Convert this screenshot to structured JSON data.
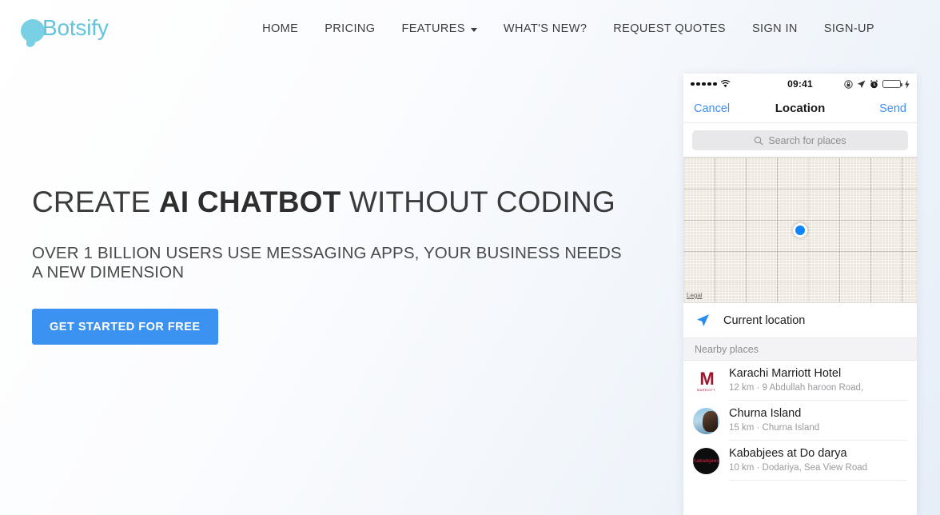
{
  "brand": {
    "name": "Botsify",
    "icon": "chat-bubble-icon",
    "color": "#62c4dd"
  },
  "nav": {
    "items": [
      {
        "label": "HOME",
        "has_caret": false
      },
      {
        "label": "PRICING",
        "has_caret": false
      },
      {
        "label": "FEATURES",
        "has_caret": true
      },
      {
        "label": "WHAT'S NEW?",
        "has_caret": false
      },
      {
        "label": "REQUEST QUOTES",
        "has_caret": false
      },
      {
        "label": "SIGN IN",
        "has_caret": false
      },
      {
        "label": "SIGN-UP",
        "has_caret": false
      }
    ]
  },
  "hero": {
    "title_part1": "CREATE ",
    "title_bold": "AI CHATBOT",
    "title_part2": " WITHOUT CODING",
    "subtitle": "OVER 1 BILLION USERS USE MESSAGING APPS, YOUR BUSINESS NEEDS A NEW DIMENSION",
    "cta_label": "GET STARTED FOR FREE",
    "cta_color": "#3c92f0"
  },
  "phone": {
    "status_bar": {
      "signal_dots": 5,
      "wifi_icon": "wifi-icon",
      "time": "09:41",
      "right_icons": [
        "rotation-lock-icon",
        "location-arrow-icon",
        "alarm-clock-icon",
        "battery-icon",
        "charging-bolt-icon"
      ],
      "battery_color": "#4cd964"
    },
    "header": {
      "cancel_label": "Cancel",
      "title": "Location",
      "send_label": "Send",
      "accent_color": "#3d8ef5"
    },
    "search": {
      "placeholder": "Search for places",
      "icon": "search-icon"
    },
    "map": {
      "pin_color": "#0a84ff",
      "legal_label": "Legal"
    },
    "current_location": {
      "icon": "navigation-arrow-icon",
      "label": "Current location"
    },
    "nearby_section_label": "Nearby places",
    "places": [
      {
        "thumb": "marriott-logo-icon",
        "thumb_glyph": "M",
        "thumb_word": "MARRIOTT",
        "name": "Karachi Marriott Hotel",
        "detail": "12 km · 9 Abdullah haroon Road,"
      },
      {
        "thumb": "churna-island-photo-icon",
        "thumb_glyph": "",
        "thumb_word": "",
        "name": "Churna Island",
        "detail": "15 km · Churna Island"
      },
      {
        "thumb": "kababjees-logo-icon",
        "thumb_glyph": "",
        "thumb_word": "Kababjees",
        "name": "Kababjees at Do darya",
        "detail": "10 km · Dodariya, Sea View Road"
      }
    ]
  }
}
